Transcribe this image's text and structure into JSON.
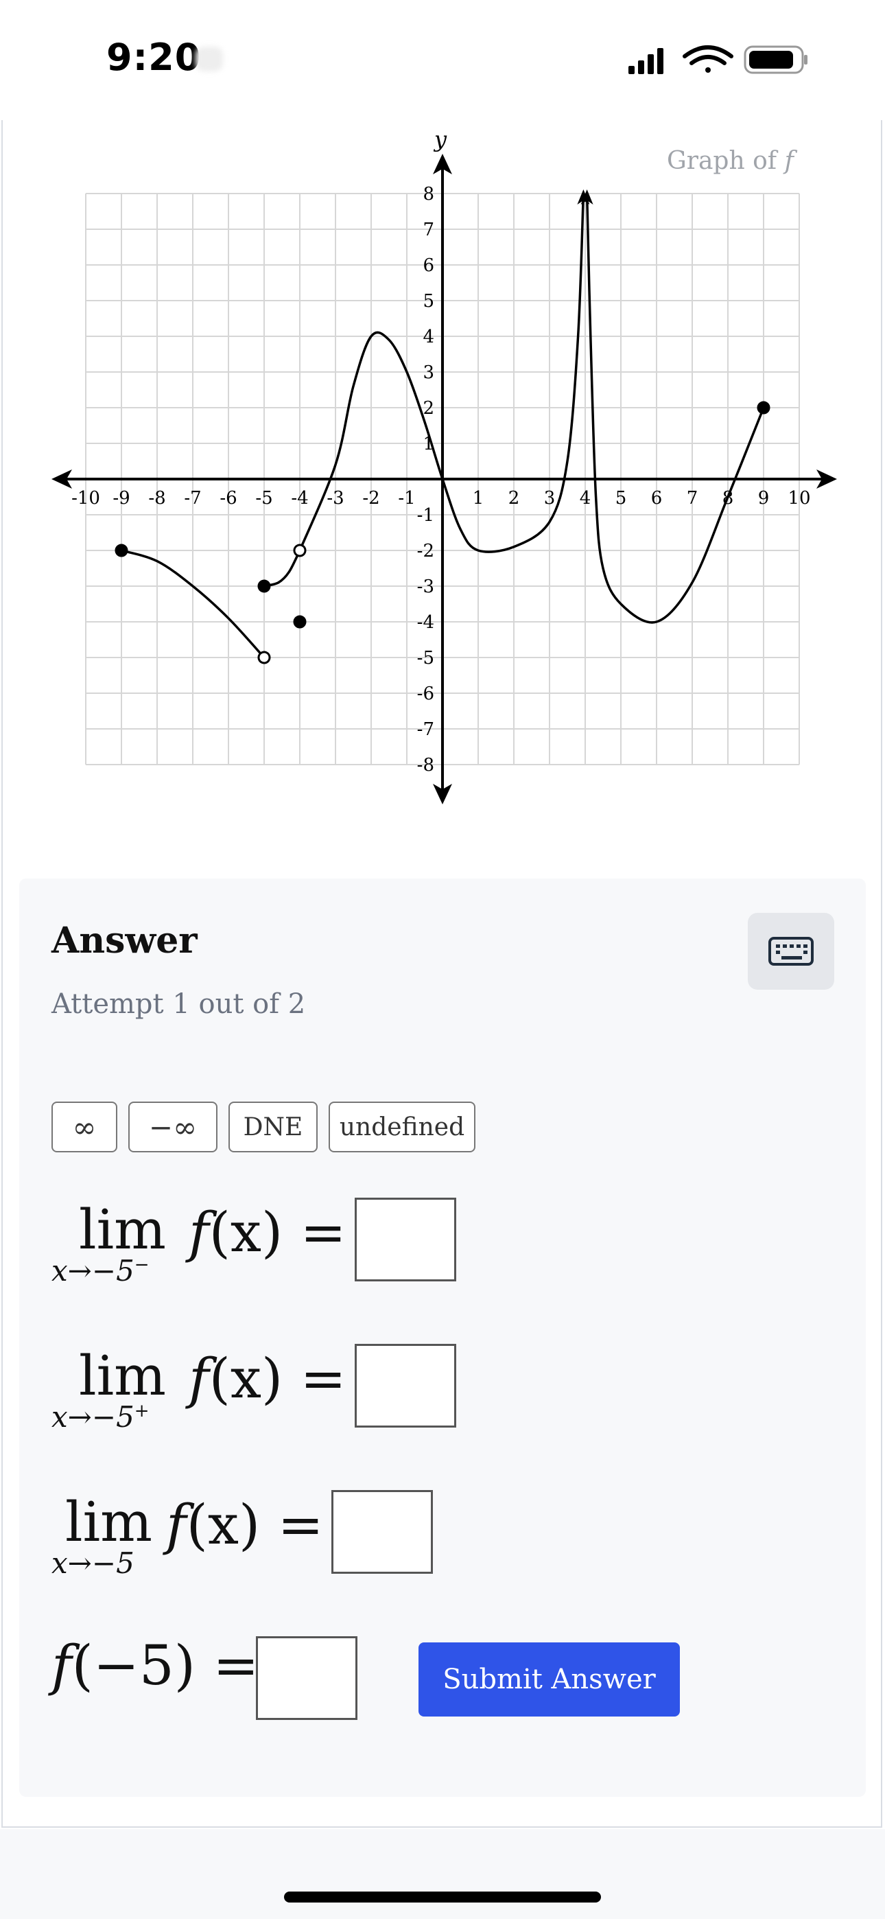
{
  "status_bar": {
    "time": "9:20"
  },
  "graph": {
    "title_prefix": "Graph of",
    "title_func": "f",
    "x_axis_label": "x",
    "y_axis_label": "y"
  },
  "chart_data": {
    "type": "line",
    "title": "Graph of f",
    "xlabel": "x",
    "ylabel": "y",
    "xlim": [
      -10,
      10
    ],
    "ylim": [
      -8,
      8
    ],
    "grid": true,
    "x_ticks": [
      -10,
      -9,
      -8,
      -7,
      -6,
      -5,
      -4,
      -3,
      -2,
      -1,
      1,
      2,
      3,
      4,
      5,
      6,
      7,
      8,
      9,
      10
    ],
    "y_ticks": [
      -8,
      -7,
      -6,
      -5,
      -4,
      -3,
      -2,
      -1,
      1,
      2,
      3,
      4,
      5,
      6,
      7,
      8
    ],
    "series": [
      {
        "points": [
          [
            -9,
            -2
          ],
          [
            -8,
            -2.3
          ],
          [
            -7,
            -3
          ],
          [
            -6,
            -3.9
          ],
          [
            -5,
            -5
          ]
        ],
        "start": "closed",
        "end": "open"
      },
      {
        "points": [
          [
            -5,
            -3
          ],
          [
            -4.6,
            -2.9
          ],
          [
            -4.3,
            -2.6
          ],
          [
            -4,
            -2
          ]
        ],
        "start": "closed",
        "end": "open"
      },
      {
        "points": [
          [
            -4,
            -2
          ],
          [
            -3,
            0.4
          ],
          [
            -2.5,
            2.6
          ],
          [
            -2,
            4
          ],
          [
            -1.5,
            3.9
          ],
          [
            -1,
            3
          ],
          [
            -0.5,
            1.6
          ],
          [
            0,
            0
          ],
          [
            0.5,
            -1.4
          ],
          [
            1,
            -2
          ],
          [
            2,
            -1.9
          ],
          [
            3,
            -1.2
          ],
          [
            3.5,
            0.5
          ],
          [
            3.8,
            4
          ],
          [
            3.95,
            8
          ]
        ],
        "start": "none",
        "end": "arrow"
      },
      {
        "points": [
          [
            4.05,
            8
          ],
          [
            4.15,
            4
          ],
          [
            4.3,
            -0.5
          ],
          [
            4.5,
            -2.5
          ],
          [
            5,
            -3.5
          ],
          [
            6,
            -4
          ],
          [
            7,
            -2.9
          ],
          [
            8,
            -0.5
          ],
          [
            9,
            2
          ]
        ],
        "start": "arrow",
        "end": "closed"
      }
    ],
    "isolated_points": [
      {
        "x": -4,
        "y": -4,
        "style": "closed"
      },
      {
        "x": -5,
        "y": -5,
        "style": "open"
      },
      {
        "x": -4,
        "y": -2,
        "style": "open"
      },
      {
        "x": -5,
        "y": -3,
        "style": "closed"
      },
      {
        "x": -9,
        "y": -2,
        "style": "closed"
      },
      {
        "x": 9,
        "y": 2,
        "style": "closed"
      }
    ],
    "vertical_asymptote_x": 4
  },
  "answer": {
    "title": "Answer",
    "attempt": "Attempt 1 out of 2",
    "symbols": [
      "∞",
      "−∞",
      "DNE",
      "undefined"
    ],
    "limits": [
      {
        "lim": "lim",
        "sub": "x→−5",
        "sup": "−",
        "expr": "= "
      },
      {
        "lim": "lim",
        "sub": "x→−5",
        "sup": "+",
        "expr": "= "
      },
      {
        "lim": "lim",
        "sub": "x→−5",
        "sup": "",
        "expr": "= "
      }
    ],
    "f_of": "f",
    "f_arg": "(x)",
    "f5_func": "f",
    "f5_rest": "(−5) =",
    "submit_label": "Submit Answer"
  }
}
